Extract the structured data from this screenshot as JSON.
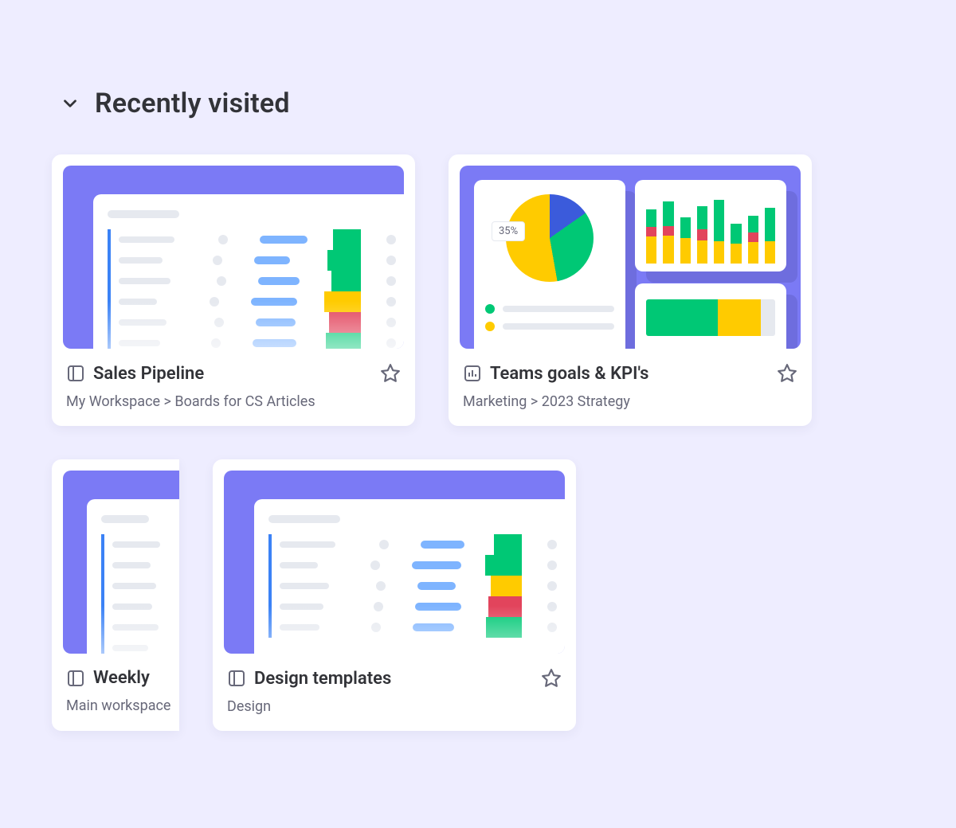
{
  "section": {
    "title": "Recently visited"
  },
  "cards": [
    {
      "type": "board",
      "title": "Sales Pipeline",
      "path": "My Workspace  >  Boards for CS Articles"
    },
    {
      "type": "dashboard",
      "title": "Teams goals & KPI's",
      "path": "Marketing  >  2023 Strategy",
      "pie_label": "35%"
    },
    {
      "type": "board",
      "title": "Weekly",
      "path": "Main workspace"
    },
    {
      "type": "board",
      "title": "Design templates",
      "path": "Design"
    }
  ],
  "colors": {
    "accent": "#7b7af5",
    "green": "#00c875",
    "yellow": "#ffcb00",
    "pink": "#e2445c",
    "blue": "#3b5bdb"
  }
}
